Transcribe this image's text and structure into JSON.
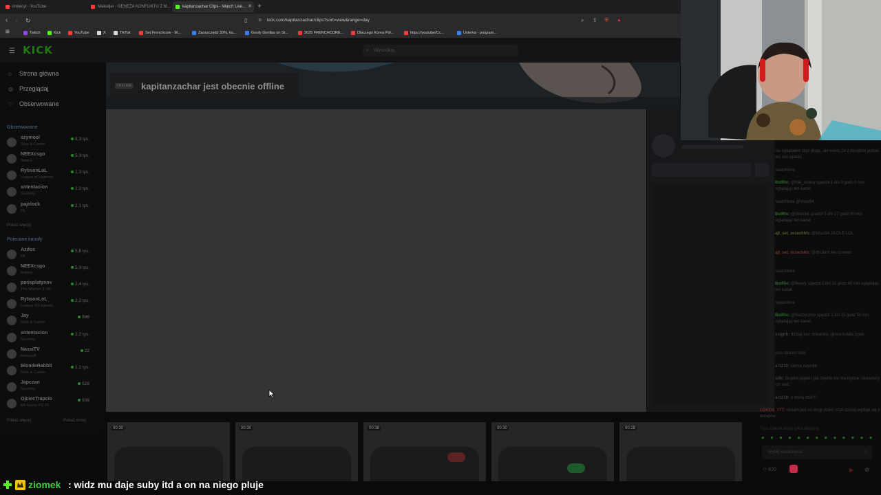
{
  "browser": {
    "tabs": [
      {
        "title": "imbecyl - YouTube",
        "color": "#ff3d3d"
      },
      {
        "title": "Maksiljer - GENEZA KONFLIKTU Z M...",
        "color": "#ff3d3d"
      },
      {
        "title": "kapitanzachar Clips - Watch Live...",
        "color": "#53fc18",
        "active": true
      }
    ],
    "new_tab": "+",
    "url": "kick.com/kapitanzachar/clips?sort=view&range=day",
    "bookmarks": [
      {
        "label": "Twitch",
        "color": "#9146ff"
      },
      {
        "label": "Kick",
        "color": "#53fc18"
      },
      {
        "label": "YouTube",
        "color": "#ff3d3d"
      },
      {
        "label": "X",
        "color": "#dddddd"
      },
      {
        "label": "TikTok",
        "color": "#dddddd"
      },
      {
        "label": "Set Frenchcore - M...",
        "color": "#ff3d3d"
      },
      {
        "label": "Zaoszczędź 30%, ku...",
        "color": "#3b82f6"
      },
      {
        "label": "Goofy Gorillas on St...",
        "color": "#3b82f6"
      },
      {
        "label": "2025 FRENCHCORE...",
        "color": "#ff3d3d"
      },
      {
        "label": "Dlaczego Korea Pół...",
        "color": "#ff3d3d"
      },
      {
        "label": "https://youtube/Cc...",
        "color": "#ff3d3d"
      },
      {
        "label": "Usterka - program...",
        "color": "#3b82f6"
      }
    ]
  },
  "kick": {
    "logo": "KICK",
    "search_placeholder": "Wyszukaj",
    "nav": [
      {
        "label": "Strona główna",
        "icon": "home-icon"
      },
      {
        "label": "Przeglądaj",
        "icon": "compass-icon"
      },
      {
        "label": "Obserwowane",
        "icon": "heart-icon"
      }
    ],
    "followed_header": "Obserwowane",
    "followed": [
      {
        "name": "szymool",
        "category": "Slots & Casino",
        "viewers": "8,3 tys."
      },
      {
        "name": "NEEXcsgo",
        "category": "Roblox",
        "viewers": "5,3 tys."
      },
      {
        "name": "RybsonLoL",
        "category": "League of Legends",
        "viewers": "2,3 tys."
      },
      {
        "name": "xntentacion",
        "category": "Scummy",
        "viewers": "2,2 tys."
      },
      {
        "name": "pajelock",
        "category": "Pit",
        "viewers": "2,1 tys."
      }
    ],
    "followed_more": "Pokaż więcej",
    "recommended_header": "Polecane kanały",
    "recommended": [
      {
        "name": "Azdus",
        "category": "Pit",
        "viewers": "5,6 tys."
      },
      {
        "name": "NEEXcsgo",
        "category": "Roblox",
        "viewers": "5,3 tys."
      },
      {
        "name": "parisplatynov",
        "category": "The Witcher 3: Wi...",
        "viewers": "2,4 tys."
      },
      {
        "name": "RybsonLoL",
        "category": "League of Legends",
        "viewers": "2,2 tys."
      },
      {
        "name": "Jay",
        "category": "Slots & Casino",
        "viewers": "588"
      },
      {
        "name": "xntentacion",
        "category": "Scummy",
        "viewers": "2,2 tys."
      },
      {
        "name": "NassiTV",
        "category": "Minecraft",
        "viewers": "22"
      },
      {
        "name": "BlondeRabbit",
        "category": "Slots & Casino",
        "viewers": "1,2 tys."
      },
      {
        "name": "Japczan",
        "category": "Scummy",
        "viewers": "528"
      },
      {
        "name": "OjciecTrapcio",
        "category": "EA Sports FC 25",
        "viewers": "509"
      }
    ],
    "rec_more": "Pokaż więcej",
    "rec_less": "Pokaż mniej",
    "offline_badge": "OFFLINE",
    "offline_title": "kapitanzachar jest obecnie offline",
    "clips": [
      {
        "duration": "00:30"
      },
      {
        "duration": "00:30"
      },
      {
        "duration": "00:38"
      },
      {
        "duration": "00:30"
      },
      {
        "duration": "00:28"
      }
    ]
  },
  "chat": {
    "messages": [
      {
        "user": "",
        "text": "nie oglądałem zbyt długo, ale wiem, że z dorejtów jednak tez coś wpada",
        "color": "#3f3f3f"
      },
      {
        "user": "",
        "text": "!watchtime",
        "color": "#3f3f3f"
      },
      {
        "user": "BotRix:",
        "text": "@Nie_istotny spędził 1 dni 9 godz 0 min oglądając ten kanał",
        "color": "#2e6b2e"
      },
      {
        "user": "",
        "text": "!watchtime @Virus94",
        "color": "#3f3f3f"
      },
      {
        "user": "BotRix:",
        "text": "@Virus94 spędził 5 dni 17 godz 30 min oglądając ten kanał",
        "color": "#2e6b2e"
      },
      {
        "user": "ajt_set_orzechhh:",
        "text": "@Virus94 JA OLE LOL",
        "color": "#5a5a2a"
      },
      {
        "user": "ajt_set_orzechhh:",
        "text": "@dhcilent ten content",
        "color": "#6a3a2a"
      },
      {
        "user": "",
        "text": "!watchtime",
        "color": "#3f3f3f"
      },
      {
        "user": "BotRix:",
        "text": "@Beevy spędził 2 dni 12 godz 45 min oglądając ten kanał",
        "color": "#2e6b2e"
      },
      {
        "user": "",
        "text": "!watchtime",
        "color": "#3f3f3f"
      },
      {
        "user": "BotRix:",
        "text": "@Nezbychno spędził 2 dni 15 godz 50 min oglądając ten kanał",
        "color": "#2e6b2e"
      },
      {
        "user": "ssigith:",
        "text": "dzisiaj bez streamku, głowa bolała zywa",
        "color": "#3f3f3f"
      },
      {
        "user": "",
        "text": "jutro stream toko",
        "color": "#3f3f3f"
      },
      {
        "user": "ar1210:",
        "text": "siema zwyrole",
        "color": "#3f3f3f"
      },
      {
        "user": "sdh:",
        "text": "Ja jebe piątek i jak zwykle nie ma bydzie, streamery ich mać",
        "color": "#3f3f3f"
      },
      {
        "user": "ar1210:",
        "text": "o której dzis??",
        "color": "#3f3f3f"
      },
      {
        "user": "LOKOS_777:",
        "text": "stream jest co drugi dzień, czyli dzisiaj wydaje się z dorejtów",
        "color": "#6a2a2a"
      },
      {
        "user": "",
        "text": "Tryb szeroki klany tylko aktywny",
        "color": "#2f2f2f"
      }
    ],
    "input_placeholder": "Wyślij wiadomość",
    "viewers": "620"
  },
  "overlay": {
    "username": "ziomek",
    "message": ": widz mu daje suby itd a on na niego pluje"
  }
}
